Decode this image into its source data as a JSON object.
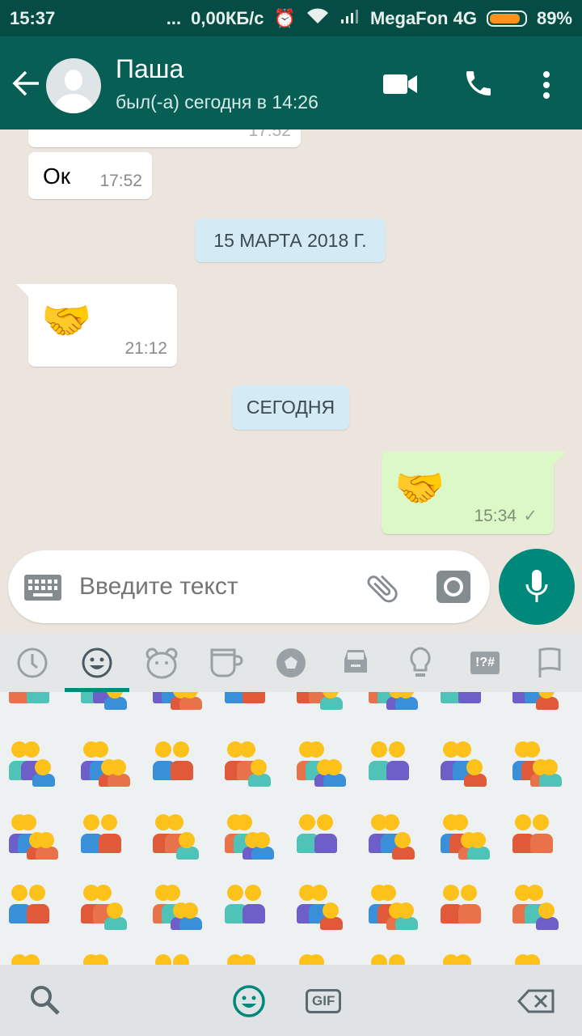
{
  "status_bar": {
    "time": "15:37",
    "dots": "...",
    "speed": "0,00КБ/с",
    "carrier": "MegaFon 4G",
    "battery": "89%",
    "battery_level": 0.89
  },
  "header": {
    "name": "Паша",
    "last_seen": "был(-а) сегодня в 14:26"
  },
  "messages": [
    {
      "direction": "in",
      "text": "",
      "time": "17:52",
      "partial": true
    },
    {
      "direction": "in",
      "text": "Ок",
      "time": "17:52"
    },
    {
      "type": "date",
      "text": "15 МАРТА 2018 Г."
    },
    {
      "direction": "in",
      "text": "🤝",
      "time": "21:12"
    },
    {
      "type": "date",
      "text": "СЕГОДНЯ"
    },
    {
      "direction": "out",
      "text": "🤝",
      "time": "15:34",
      "status": "✓"
    }
  ],
  "input": {
    "placeholder": "Введите текст"
  },
  "emoji_tabs": [
    "recent",
    "smileys",
    "animals",
    "food",
    "activity",
    "travel",
    "objects",
    "symbols",
    "flags"
  ],
  "emoji_tabs_active": "smileys",
  "bottom_bar": {
    "gif_label": "GIF"
  },
  "colors": {
    "header": "#075e54",
    "status": "#054d44",
    "accent": "#00897b",
    "outgoing": "#dcf8c6",
    "date_chip": "#d4eaf4"
  }
}
